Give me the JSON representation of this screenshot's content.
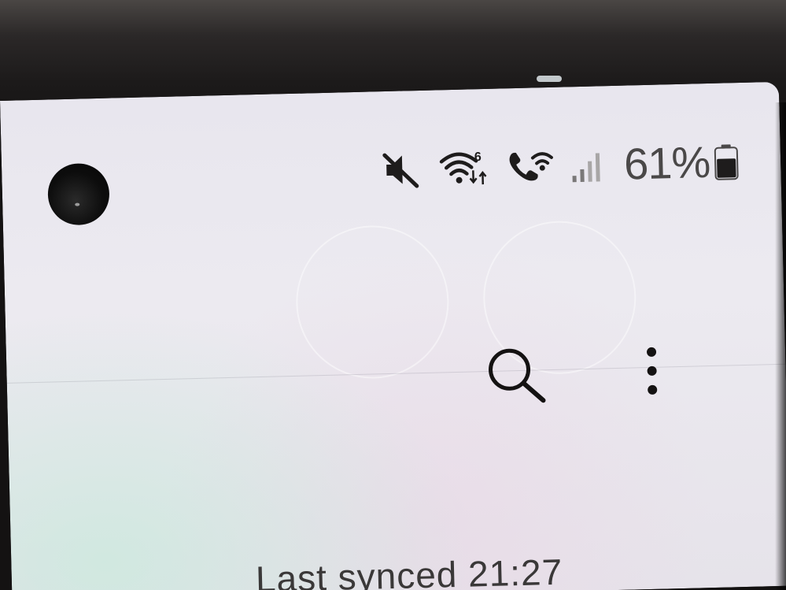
{
  "status_bar": {
    "battery_text": "61%",
    "icons": [
      "mute-icon",
      "wifi-6-icon",
      "wifi-calling-icon",
      "signal-bars-icon",
      "battery-icon"
    ]
  },
  "toolbar": {
    "search_icon": "search-icon",
    "menu_icon": "more-options-icon"
  },
  "sync": {
    "text": "Last synced 21:27"
  },
  "colors": {
    "screen_bg": "#eceaf0",
    "icon_dark": "#1e1c1c",
    "text_gray": "#4a4848"
  }
}
